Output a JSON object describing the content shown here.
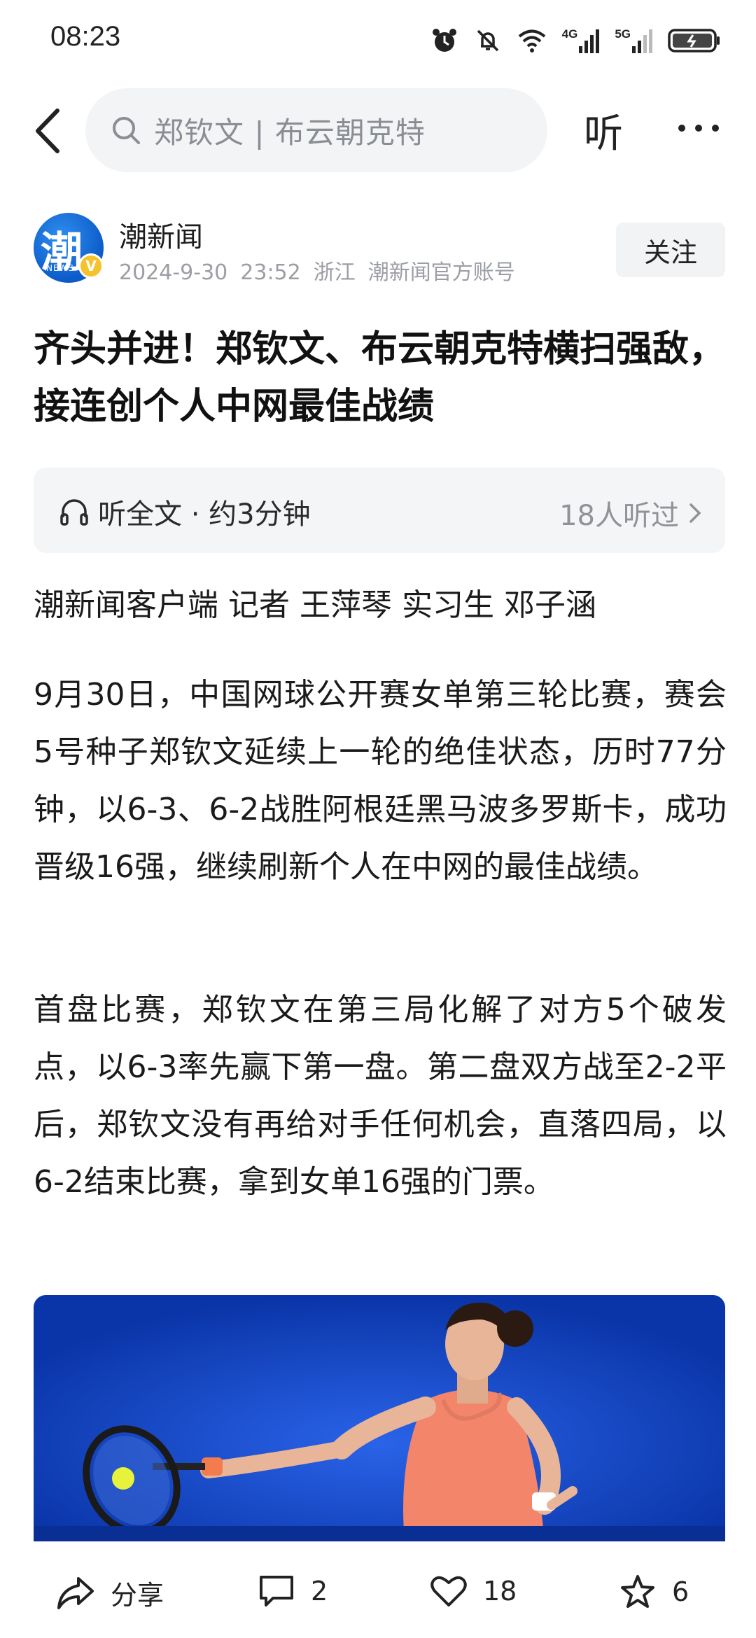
{
  "status_bar": {
    "time": "08:23",
    "net1_label": "4G",
    "net2_label": "5G",
    "icons": [
      "alarm-icon",
      "mute-icon",
      "wifi-icon",
      "signal-icon",
      "battery-icon"
    ]
  },
  "nav": {
    "search_text": "郑钦文 | 布云朝克特",
    "listen_label": "听"
  },
  "author": {
    "avatar_char": "潮",
    "avatar_sub": "NEWS",
    "verify_mark": "V",
    "name": "潮新闻",
    "date": "2024-9-30",
    "time": "23:52",
    "region": "浙江",
    "account_type": "潮新闻官方账号",
    "follow_label": "关注"
  },
  "article": {
    "title": "齐头并进！郑钦文、布云朝克特横扫强敌，接连创个人中网最佳战绩",
    "listen_label": "听全文 · 约3分钟",
    "listeners": "18人听过",
    "byline": "潮新闻客户端 记者 王萍琴 实习生 邓子涵",
    "paragraphs": [
      "9月30日，中国网球公开赛女单第三轮比赛，赛会5号种子郑钦文延续上一轮的绝佳状态，历时77分钟，以6-3、6-2战胜阿根廷黑马波多罗斯卡，成功晋级16强，继续刷新个人在中网的最佳战绩。",
      "首盘比赛，郑钦文在第三局化解了对方5个破发点，以6-3率先赢下第一盘。第二盘双方战至2-2平后，郑钦文没有再给对手任何机会，直落四局，以6-2结束比赛，拿到女单16强的门票。"
    ]
  },
  "bottom_bar": {
    "share_label": "分享",
    "comment_count": "2",
    "like_count": "18",
    "fav_count": "6"
  }
}
